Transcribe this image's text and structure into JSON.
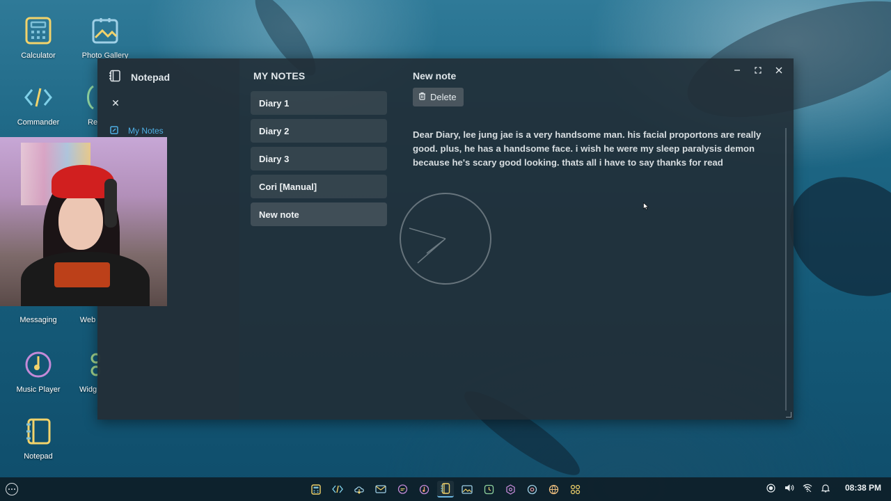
{
  "desktop": {
    "icons": [
      {
        "label": "Calculator",
        "icon": "calculator-icon",
        "color": "#7ec0d8"
      },
      {
        "label": "Photo Gallery",
        "icon": "photo-gallery-icon",
        "color": "#9fd0e6"
      },
      {
        "label": "Commander",
        "icon": "code-icon",
        "color": "#7fd0e8"
      },
      {
        "label": "Re",
        "icon": "recycle-icon",
        "color": "#8fd39f"
      },
      {
        "label": "Messaging",
        "icon": "messaging-icon",
        "color": "#f2a0a8"
      },
      {
        "label": "Web",
        "icon": "web-browser-icon",
        "color": "#f0c080"
      },
      {
        "label": "Music Player",
        "icon": "music-player-icon",
        "color": "#f0a070"
      },
      {
        "label": "Widg",
        "icon": "widgets-icon",
        "color": "#a0d08a"
      },
      {
        "label": "Notepad",
        "icon": "notepad-icon",
        "color": "#f0d070"
      }
    ]
  },
  "window": {
    "app_title": "Notepad",
    "nav": {
      "my_notes_label": "My Notes"
    },
    "notes_heading": "MY NOTES",
    "notes": [
      {
        "title": "Diary 1"
      },
      {
        "title": "Diary 2"
      },
      {
        "title": "Diary 3"
      },
      {
        "title": "Cori [Manual]"
      },
      {
        "title": "New note"
      }
    ],
    "editor": {
      "title": "New note",
      "delete_label": "Delete",
      "body": "Dear Diary, lee jung jae is a very handsome man. his facial proportons are really good. plus, he has a handsome face. i wish he were my sleep paralysis demon because he's scary good looking. thats all i have to say thanks for read"
    },
    "controls": {
      "minimize": "–",
      "maximize": "⛶",
      "close": "✕"
    }
  },
  "taskbar": {
    "apps": [
      "calculator-icon",
      "code-icon",
      "cloud-icon",
      "mail-icon",
      "chat-icon",
      "music-icon",
      "notepad-icon",
      "gallery-icon",
      "clock-icon",
      "settings-icon",
      "apps-icon",
      "web-icon",
      "grid-icon"
    ],
    "active_app": "notepad-icon",
    "clock": "08:38 PM"
  },
  "colors": {
    "accent": "#4fb0e6",
    "window_bg": "#212d36"
  }
}
